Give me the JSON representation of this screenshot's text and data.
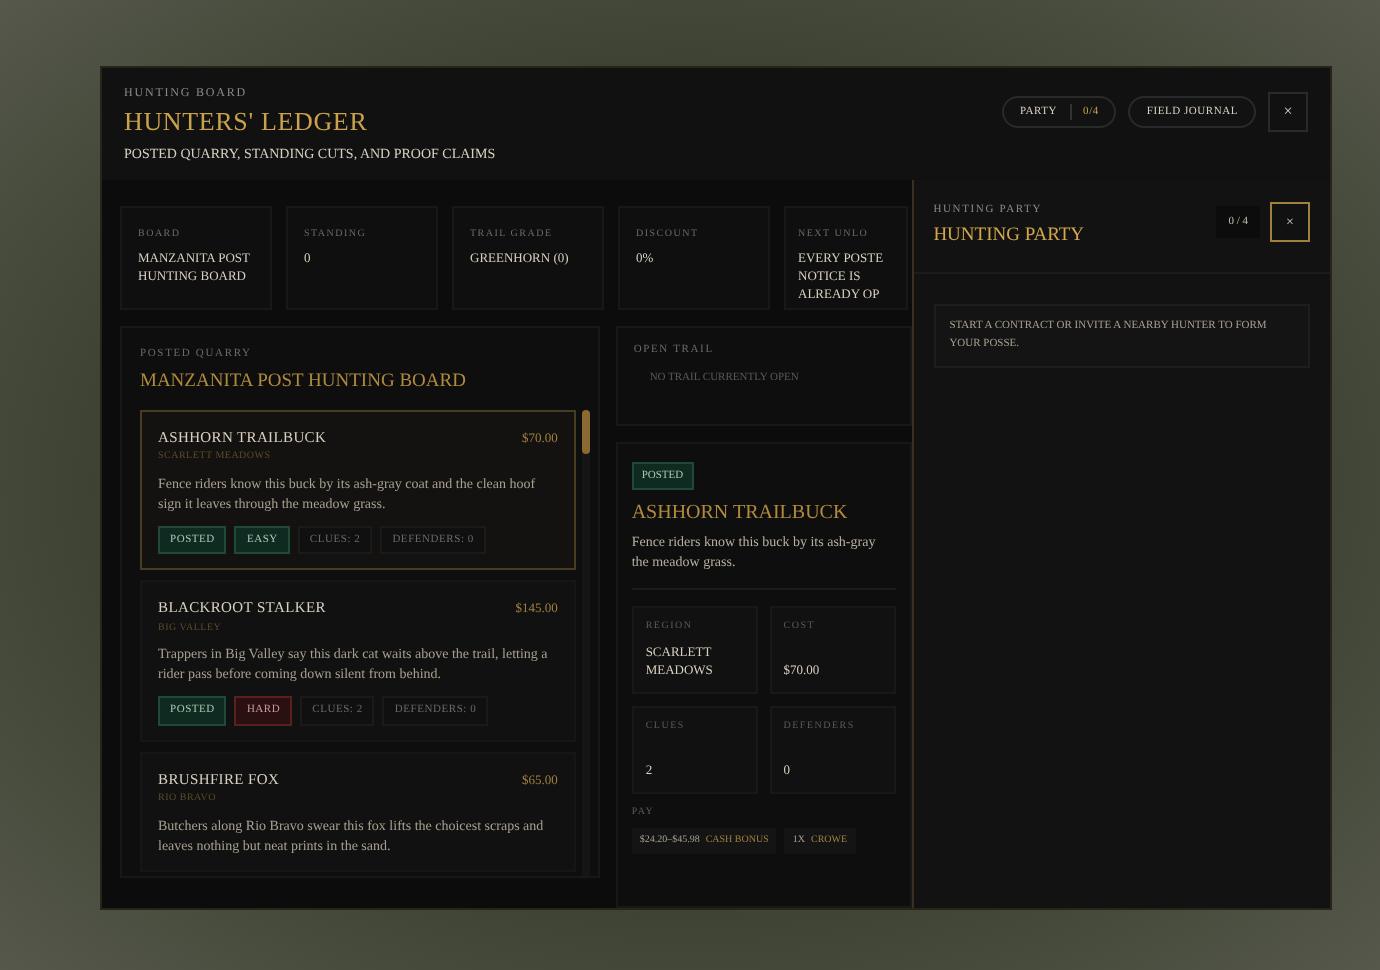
{
  "header": {
    "kicker": "HUNTING BOARD",
    "title": "HUNTERS' LEDGER",
    "subtitle": "POSTED QUARRY, STANDING CUTS, AND PROOF CLAIMS",
    "party_label": "PARTY",
    "party_count": "0/4",
    "journal_button": "FIELD JOURNAL",
    "close": "×"
  },
  "stats": [
    {
      "label": "BOARD",
      "value": "MANZANITA POST HUNTING BOARD"
    },
    {
      "label": "STANDING",
      "value": "0"
    },
    {
      "label": "TRAIL GRADE",
      "value": "GREENHORN (0)"
    },
    {
      "label": "DISCOUNT",
      "value": "0%"
    },
    {
      "label": "NEXT UNLO",
      "value": "EVERY POSTE NOTICE IS ALREADY OP"
    }
  ],
  "listing": {
    "kicker": "POSTED QUARRY",
    "title": "MANZANITA POST HUNTING BOARD",
    "items": [
      {
        "name": "ASHHORN TRAILBUCK",
        "region": "SCARLETT MEADOWS",
        "price": "$70.00",
        "description": "Fence riders know this buck by its ash-gray coat and the clean hoof sign it leaves through the meadow grass.",
        "selected": true,
        "tags": [
          {
            "text": "POSTED",
            "kind": "status"
          },
          {
            "text": "EASY",
            "kind": "easy"
          },
          {
            "text": "CLUES: 2",
            "kind": "plain"
          },
          {
            "text": "DEFENDERS: 0",
            "kind": "plain"
          }
        ]
      },
      {
        "name": "BLACKROOT STALKER",
        "region": "BIG VALLEY",
        "price": "$145.00",
        "description": "Trappers in Big Valley say this dark cat waits above the trail, letting a rider pass before coming down silent from behind.",
        "selected": false,
        "tags": [
          {
            "text": "POSTED",
            "kind": "status"
          },
          {
            "text": "HARD",
            "kind": "hard"
          },
          {
            "text": "CLUES: 2",
            "kind": "plain"
          },
          {
            "text": "DEFENDERS: 0",
            "kind": "plain"
          }
        ]
      },
      {
        "name": "BRUSHFIRE FOX",
        "region": "RIO BRAVO",
        "price": "$65.00",
        "description": "Butchers along Rio Bravo swear this fox lifts the choicest scraps and leaves nothing but neat prints in the sand.",
        "selected": false
      }
    ]
  },
  "open_trail": {
    "label": "OPEN TRAIL",
    "message": "NO TRAIL CURRENTLY OPEN"
  },
  "detail": {
    "badge": "POSTED",
    "title": "ASHHORN TRAILBUCK",
    "description_lines": [
      "Fence riders know this buck by its ash-gray",
      "the meadow grass."
    ],
    "facts": [
      {
        "label": "REGION",
        "value": "SCARLETT MEADOWS"
      },
      {
        "label": "COST",
        "value": "$70.00"
      },
      {
        "label": "CLUES",
        "value": "2"
      },
      {
        "label": "DEFENDERS",
        "value": "0"
      }
    ],
    "pay_label": "PAY",
    "pay": [
      {
        "amount": "$24.20–$45.98",
        "label": "CASH BONUS"
      },
      {
        "amount": "1X",
        "label": "CROWE"
      }
    ]
  },
  "party_panel": {
    "kicker": "HUNTING PARTY",
    "title": "HUNTING PARTY",
    "count": "0 / 4",
    "close": "×",
    "message": "START A CONTRACT OR INVITE A NEARBY HUNTER TO FORM YOUR POSSE."
  }
}
